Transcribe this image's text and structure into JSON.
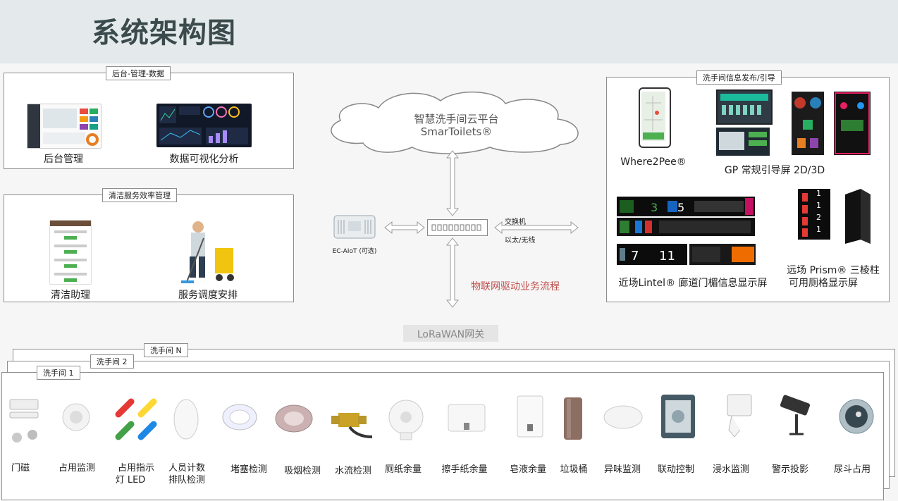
{
  "title": "系统架构图",
  "backend_panel": {
    "tab": "后台-管理-数据",
    "items": [
      {
        "label": "后台管理"
      },
      {
        "label": "数据可视化分析"
      }
    ]
  },
  "cleaning_panel": {
    "tab": "清洁服务效率管理",
    "items": [
      {
        "label": "清洁助理"
      },
      {
        "label": "服务调度安排"
      }
    ]
  },
  "cloud": {
    "line1": "智慧洗手间云平台",
    "line2": "SmarToilets®"
  },
  "switch": {
    "label": "交换机",
    "sublabel": "以太/无线"
  },
  "ec_aiot": "EC-AIoT (可选)",
  "iot_flow": "物联网驱动业务流程",
  "lorawan": "LoRaWAN网关",
  "display_panel": {
    "tab": "洗手间信息发布/引导",
    "items": [
      {
        "label": "Where2Pee®"
      },
      {
        "label": "GP 常规引导屏 2D/3D"
      },
      {
        "label": "近场Lintel® 廊道门楣信息显示屏"
      },
      {
        "label_line1": "远场 Prism® 三棱柱",
        "label_line2": "可用厕格显示屏"
      }
    ],
    "lintel_numbers": [
      "3",
      "5",
      "7",
      "11"
    ],
    "prism_numbers": [
      "1",
      "1",
      "2",
      "1"
    ]
  },
  "restrooms": {
    "tabs": [
      "洗手间 N",
      "洗手间 2",
      "洗手间 1"
    ],
    "sensors": [
      {
        "label": "门磁",
        "icon": "door-sensor-icon"
      },
      {
        "label": "占用监测",
        "icon": "occupancy-sensor-icon"
      },
      {
        "label_line1": "占用指示",
        "label_line2": "灯 LED",
        "icon": "led-indicator-icon"
      },
      {
        "label_line1": "人员计数",
        "label_line2": "排队检测",
        "icon": "people-counter-icon"
      },
      {
        "label": "堵塞检测",
        "icon": "clog-sensor-icon"
      },
      {
        "label": "吸烟检测",
        "icon": "smoke-sensor-icon"
      },
      {
        "label": "水流检测",
        "icon": "water-flow-icon"
      },
      {
        "label": "厕纸余量",
        "icon": "toilet-paper-icon"
      },
      {
        "label": "擦手纸余量",
        "icon": "hand-towel-icon"
      },
      {
        "label": "皂液余量",
        "icon": "soap-dispenser-icon"
      },
      {
        "label": "垃圾桶",
        "icon": "trash-bin-icon"
      },
      {
        "label": "异味监测",
        "icon": "odor-sensor-icon"
      },
      {
        "label": "联动控制",
        "icon": "linkage-control-icon"
      },
      {
        "label": "浸水监测",
        "icon": "flood-sensor-icon"
      },
      {
        "label": "警示投影",
        "icon": "warning-projector-icon"
      },
      {
        "label": "尿斗占用",
        "icon": "urinal-sensor-icon"
      }
    ]
  }
}
